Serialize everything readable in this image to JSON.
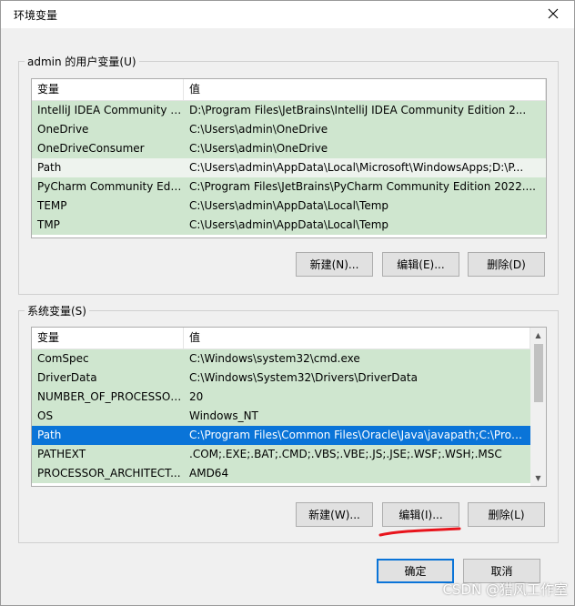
{
  "window": {
    "title": "环境变量",
    "close_icon": "close-icon"
  },
  "user_vars": {
    "group_label": "admin 的用户变量(U)",
    "columns": [
      "变量",
      "值"
    ],
    "rows": [
      {
        "name": "IntelliJ IDEA Community E...",
        "value": "D:\\Program Files\\JetBrains\\IntelliJ IDEA Community Edition 2..."
      },
      {
        "name": "OneDrive",
        "value": "C:\\Users\\admin\\OneDrive"
      },
      {
        "name": "OneDriveConsumer",
        "value": "C:\\Users\\admin\\OneDrive"
      },
      {
        "name": "Path",
        "value": "C:\\Users\\admin\\AppData\\Local\\Microsoft\\WindowsApps;D:\\P..."
      },
      {
        "name": "PyCharm Community Editi...",
        "value": "C:\\Program Files\\JetBrains\\PyCharm Community Edition 2022...."
      },
      {
        "name": "TEMP",
        "value": "C:\\Users\\admin\\AppData\\Local\\Temp"
      },
      {
        "name": "TMP",
        "value": "C:\\Users\\admin\\AppData\\Local\\Temp"
      }
    ],
    "buttons": {
      "new": "新建(N)...",
      "edit": "编辑(E)...",
      "delete": "删除(D)"
    }
  },
  "system_vars": {
    "group_label": "系统变量(S)",
    "columns": [
      "变量",
      "值"
    ],
    "selected_row": "Path",
    "rows": [
      {
        "name": "ComSpec",
        "value": "C:\\Windows\\system32\\cmd.exe"
      },
      {
        "name": "DriverData",
        "value": "C:\\Windows\\System32\\Drivers\\DriverData"
      },
      {
        "name": "NUMBER_OF_PROCESSORS",
        "value": "20"
      },
      {
        "name": "OS",
        "value": "Windows_NT"
      },
      {
        "name": "Path",
        "value": "C:\\Program Files\\Common Files\\Oracle\\Java\\javapath;C:\\Prog..."
      },
      {
        "name": "PATHEXT",
        "value": ".COM;.EXE;.BAT;.CMD;.VBS;.VBE;.JS;.JSE;.WSF;.WSH;.MSC"
      },
      {
        "name": "PROCESSOR_ARCHITECT...",
        "value": "AMD64"
      }
    ],
    "buttons": {
      "new": "新建(W)...",
      "edit": "编辑(I)...",
      "delete": "删除(L)"
    }
  },
  "footer": {
    "ok": "确定",
    "cancel": "取消"
  },
  "watermark": "CSDN @猎风工作室",
  "colors": {
    "row_bg": "#cfe6cf",
    "row_alt_bg": "#eef3ee",
    "selected_bg": "#0a74d8",
    "annotation_red": "#e8141c"
  }
}
